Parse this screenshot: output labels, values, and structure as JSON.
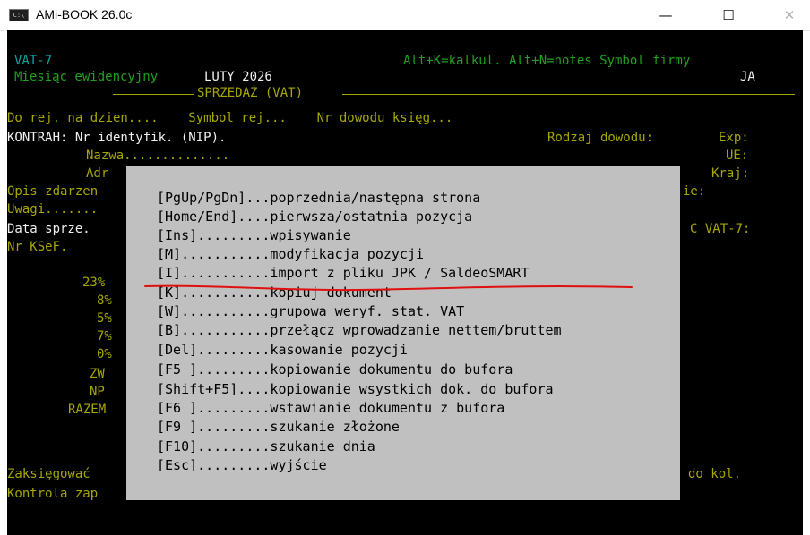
{
  "window": {
    "title": "AMi-BOOK 26.0c",
    "icon_text": "C:\\",
    "minimize_glyph": "—",
    "maximize_glyph": "☐",
    "close_glyph": "✕"
  },
  "header": {
    "form_name": "VAT-7",
    "hotkeys": "Alt+K=kalkul. Alt+N=notes Symbol firmy",
    "month_label": "Miesiąc ewidencyjny",
    "month_value": "LUTY 2026",
    "firm_symbol": "JA",
    "section_title": "SPRZEDAŻ (VAT)"
  },
  "form": {
    "row1": "Do rej. na dzien....    Symbol rej...    Nr dowodu księg...",
    "kontrah": "KONTRAH: Nr identyfik. (NIP).",
    "rodzaj": "Rodzaj dowodu:",
    "exp": "Exp:",
    "nazwa": "Nazwa..............",
    "ue": "UE:",
    "adr": "Adr",
    "kraj": "Kraj:",
    "opis": "Opis zdarzen",
    "opis_right": "ie:",
    "uwagi": "Uwagi.......",
    "data_sprze": "Data sprze.",
    "c_vat7": "C VAT-7:",
    "ksef": "Nr KSeF.",
    "rates": [
      "23%",
      "8%",
      "5%",
      "7%",
      "0%",
      "ZW",
      "NP",
      "RAZEM"
    ],
    "zaks": "Zaksięgować",
    "do_kol": "do kol.",
    "kontrola": "Kontrola zap"
  },
  "help": {
    "items": [
      "[PgUp/PgDn]...poprzednia/następna strona",
      "[Home/End]....pierwsza/ostatnia pozycja",
      "[Ins].........wpisywanie",
      "[M]...........modyfikacja pozycji",
      "[I]...........import z pliku JPK / SaldeoSMART",
      "[K]...........kopiuj dokument",
      "[W]...........grupowa weryf. stat. VAT",
      "[B]...........przełącz wprowadzanie nettem/bruttem",
      "[Del].........kasowanie pozycji",
      "[F5 ].........kopiowanie dokumentu do bufora",
      "[Shift+F5]....kopiowanie wsystkich dok. do bufora",
      "[F6 ].........wstawianie dokumentu z bufora",
      "[F9 ].........szukanie złożone",
      "[F10].........szukanie dnia",
      "[Esc].........wyjście"
    ]
  },
  "colors": {
    "background": "#000000",
    "dim_yellow": "#a6a600",
    "teal": "#0fa0a0",
    "green": "#1fa01f",
    "popup_bg": "#c0c0c0",
    "annotation_red": "#e01010"
  }
}
